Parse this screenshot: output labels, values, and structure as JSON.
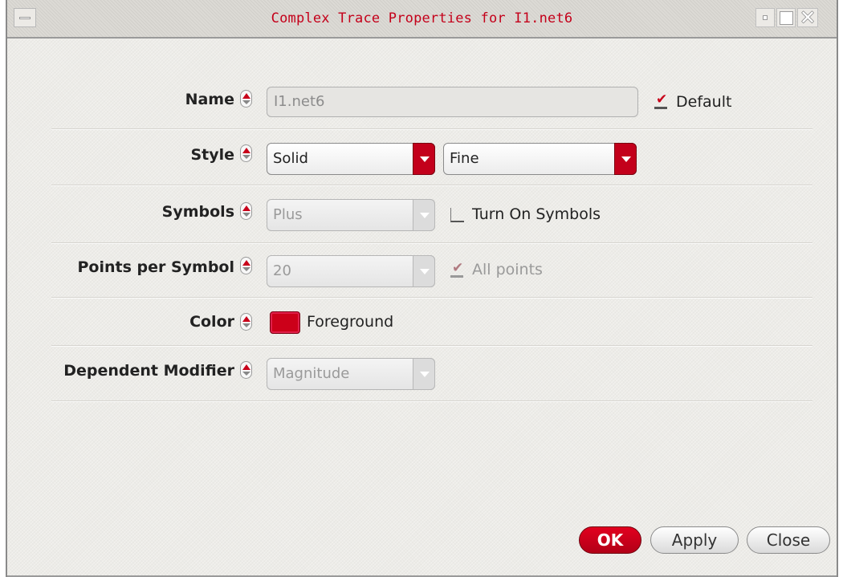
{
  "window": {
    "title": "Complex Trace Properties for I1.net6"
  },
  "name_row": {
    "label": "Name",
    "value": "I1.net6",
    "default_label": "Default",
    "default_checked": true
  },
  "style_row": {
    "label": "Style",
    "line_style": "Solid",
    "line_width": "Fine"
  },
  "symbols_row": {
    "label": "Symbols",
    "value": "Plus",
    "turn_on_label": "Turn On Symbols",
    "turn_on_checked": false
  },
  "points_row": {
    "label": "Points per Symbol",
    "value": "20",
    "all_points_label": "All points",
    "all_points_checked": true
  },
  "color_row": {
    "label": "Color",
    "swatch_color": "#cc0019",
    "value": "Foreground"
  },
  "modifier_row": {
    "label": "Dependent Modifier",
    "value": "Magnitude"
  },
  "buttons": {
    "ok": "OK",
    "apply": "Apply",
    "close": "Close"
  },
  "theme": {
    "accent": "#c3001b",
    "title_color": "#c4001a"
  },
  "icons": {
    "menu": "window-menu-icon",
    "minimize": "minimize-icon",
    "maximize": "maximize-icon",
    "close": "close-window-icon",
    "spin": "spin-arrow-icon",
    "dropdown": "dropdown-arrow-icon"
  }
}
